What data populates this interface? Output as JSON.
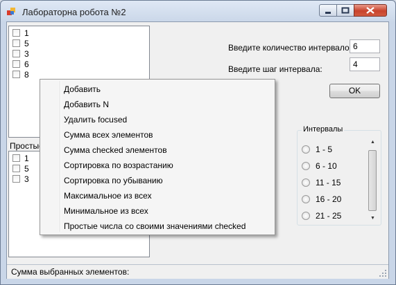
{
  "window": {
    "title": "Лабораторна робота №2",
    "controls": {
      "minimize_icon": "minimize-icon",
      "maximize_icon": "maximize-icon",
      "close_icon": "close-icon"
    }
  },
  "list_top": {
    "items": [
      "1",
      "5",
      "3",
      "6",
      "8"
    ]
  },
  "list_bottom": {
    "label": "Простые",
    "items": [
      "1",
      "5",
      "3"
    ]
  },
  "form": {
    "intervals_count_label": "Введите количество интервалов:",
    "intervals_count_value": "6",
    "interval_step_label": "Введите шаг интервала:",
    "interval_step_value": "4",
    "ok_label": "OK"
  },
  "intervals_group": {
    "title": "Интервалы",
    "options": [
      "1 - 5",
      "6 - 10",
      "11 - 15",
      "16 - 20",
      "21 - 25"
    ]
  },
  "status": {
    "text": "Сумма выбранных элементов:"
  },
  "context_menu": {
    "items": [
      "Добавить",
      "Добавить N",
      "Удалить focused",
      "Сумма всех элементов",
      "Сумма checked элементов",
      "Сортировка по возрастанию",
      "Сортировка по убыванию",
      "Максимальное из всех",
      "Минимальное из всех",
      "Простые числа со своими значениями checked"
    ]
  },
  "colors": {
    "close_button": "#c8432c",
    "window_frame": "#c9d6e8",
    "client_bg": "#f0f0f0"
  }
}
